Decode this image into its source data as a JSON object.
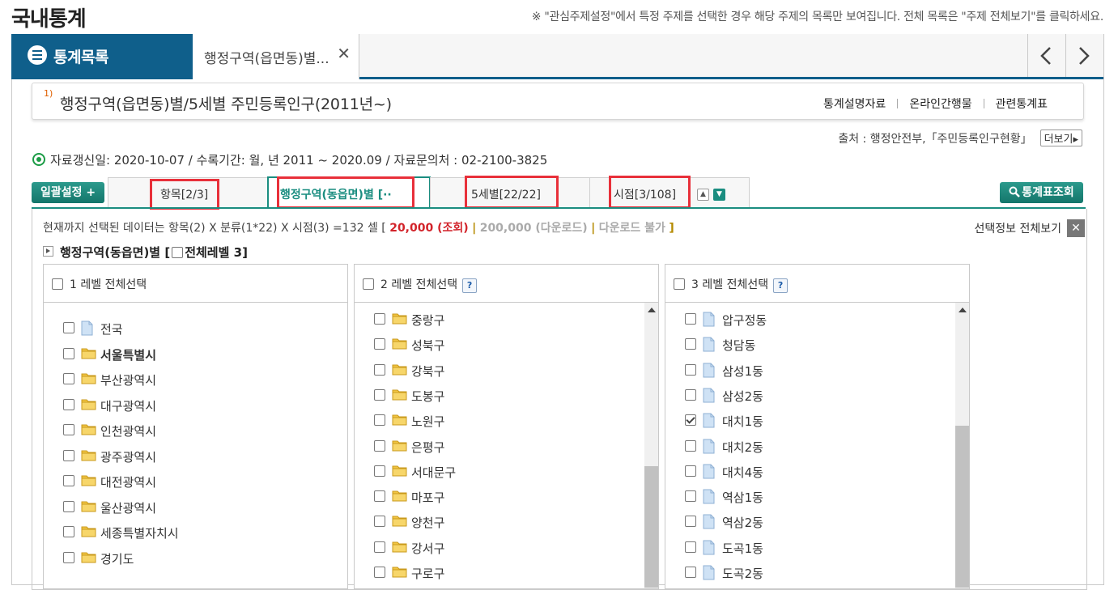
{
  "page": {
    "title": "국내통계",
    "notice": "※ \"관심주제설정\"에서 특정 주제를 선택한 경우 해당 주제의 목록만 보여집니다. 전체 목록은 \"주제 전체보기\"를 클릭하세요."
  },
  "tabs": {
    "stat_list_label": "통계목록",
    "open_tab_label": "행정구역(읍면동)별...",
    "open_tab_close": "✕"
  },
  "table": {
    "ref_mark": "1)",
    "title": "행정구역(읍면동)별/5세별 주민등록인구(2011년~)",
    "links": [
      "통계설명자료",
      "온라인간행물",
      "관련통계표"
    ],
    "source": "출처 : 행정안전부,「주민등록인구현황」",
    "more_label": "더보기▸",
    "updated": "자료갱신일: 2020-10-07 / 수록기간: 월, 년 2011 ~ 2020.09 / 자료문의처 : 02-2100-3825"
  },
  "filters": {
    "bulk_button": "일괄설정 +",
    "query_button": "통계표조회",
    "tabs": [
      {
        "label": "항목[2/3]",
        "highlighted": true,
        "active": false
      },
      {
        "label": "행정구역(동읍면)별 [··",
        "highlighted": true,
        "active": true
      },
      {
        "label": "5세별[22/22]",
        "highlighted": true,
        "active": false
      },
      {
        "label": "시점[3/108]",
        "highlighted": true,
        "active": false
      }
    ]
  },
  "summary": {
    "prefix": "현재까지 선택된 데이터는 항목(2) X 분류(1*22) X 시점(3) =132 셀 [",
    "view_limit": "20,000 (조회)",
    "sep1": "|",
    "download_limit": "200,000 (다운로드)",
    "sep2": "|",
    "download_status": "다운로드 불가",
    "suffix": "]",
    "selinfo_label": "선택정보 전체보기"
  },
  "classification": {
    "title_prefix": "행정구역(동읍면)별 [",
    "title_suffix": "전체레벨 3]"
  },
  "levels": [
    {
      "header": "1 레벨 전체선택",
      "help": false,
      "items": [
        {
          "label": "전국",
          "icon": "file",
          "checked": false,
          "bold": false
        },
        {
          "label": "서울특별시",
          "icon": "folder",
          "checked": false,
          "bold": true
        },
        {
          "label": "부산광역시",
          "icon": "folder",
          "checked": false,
          "bold": false
        },
        {
          "label": "대구광역시",
          "icon": "folder",
          "checked": false,
          "bold": false
        },
        {
          "label": "인천광역시",
          "icon": "folder",
          "checked": false,
          "bold": false
        },
        {
          "label": "광주광역시",
          "icon": "folder",
          "checked": false,
          "bold": false
        },
        {
          "label": "대전광역시",
          "icon": "folder",
          "checked": false,
          "bold": false
        },
        {
          "label": "울산광역시",
          "icon": "folder",
          "checked": false,
          "bold": false
        },
        {
          "label": "세종특별자치시",
          "icon": "folder",
          "checked": false,
          "bold": false
        },
        {
          "label": "경기도",
          "icon": "folder",
          "checked": false,
          "bold": false
        }
      ]
    },
    {
      "header": "2 레벨 전체선택",
      "help": true,
      "help_label": "?",
      "scroll": {
        "position": 0.55,
        "size": 0.45
      },
      "items": [
        {
          "label": "중랑구",
          "icon": "folder",
          "checked": false
        },
        {
          "label": "성북구",
          "icon": "folder",
          "checked": false
        },
        {
          "label": "강북구",
          "icon": "folder",
          "checked": false
        },
        {
          "label": "도봉구",
          "icon": "folder",
          "checked": false
        },
        {
          "label": "노원구",
          "icon": "folder",
          "checked": false
        },
        {
          "label": "은평구",
          "icon": "folder",
          "checked": false
        },
        {
          "label": "서대문구",
          "icon": "folder",
          "checked": false
        },
        {
          "label": "마포구",
          "icon": "folder",
          "checked": false
        },
        {
          "label": "양천구",
          "icon": "folder",
          "checked": false
        },
        {
          "label": "강서구",
          "icon": "folder",
          "checked": false
        },
        {
          "label": "구로구",
          "icon": "folder",
          "checked": false
        }
      ]
    },
    {
      "header": "3 레벨 전체선택",
      "help": true,
      "help_label": "?",
      "scroll": {
        "position": 0.4,
        "size": 0.6
      },
      "items": [
        {
          "label": "압구정동",
          "icon": "file",
          "checked": false
        },
        {
          "label": "청담동",
          "icon": "file",
          "checked": false
        },
        {
          "label": "삼성1동",
          "icon": "file",
          "checked": false
        },
        {
          "label": "삼성2동",
          "icon": "file",
          "checked": false
        },
        {
          "label": "대치1동",
          "icon": "file",
          "checked": true
        },
        {
          "label": "대치2동",
          "icon": "file",
          "checked": false
        },
        {
          "label": "대치4동",
          "icon": "file",
          "checked": false
        },
        {
          "label": "역삼1동",
          "icon": "file",
          "checked": false
        },
        {
          "label": "역삼2동",
          "icon": "file",
          "checked": false
        },
        {
          "label": "도곡1동",
          "icon": "file",
          "checked": false
        },
        {
          "label": "도곡2동",
          "icon": "file",
          "checked": false
        }
      ]
    }
  ],
  "colors": {
    "brand_blue": "#0f5f8b",
    "teal": "#1a8d80",
    "highlight_red": "#e8303a",
    "limit_red": "#d2232a",
    "folder_yellow": "#f2c543",
    "file_blue": "#cfe2f5"
  }
}
